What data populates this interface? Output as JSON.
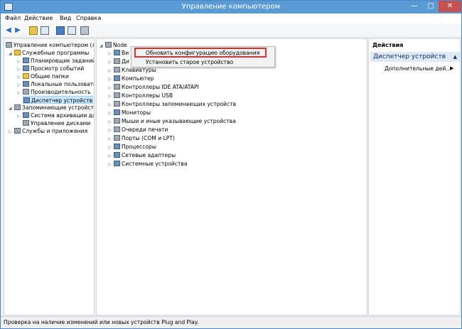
{
  "window": {
    "title": "Управление компьютером"
  },
  "menu": [
    "Файл",
    "Действие",
    "Вид",
    "Справка"
  ],
  "left_tree": [
    {
      "label": "Управление компьютером (л",
      "icon": "computer-management-icon"
    },
    {
      "label": "Служебные программы",
      "icon": "tools-icon"
    },
    {
      "label": "Планировщик заданий",
      "icon": "task-scheduler-icon"
    },
    {
      "label": "Просмотр событий",
      "icon": "event-viewer-icon"
    },
    {
      "label": "Общие папки",
      "icon": "shared-folder-icon"
    },
    {
      "label": "Локальные пользовате",
      "icon": "users-icon"
    },
    {
      "label": "Производительность",
      "icon": "performance-icon"
    },
    {
      "label": "Диспетчер устройств",
      "icon": "device-manager-icon"
    },
    {
      "label": "Запоминающие устройст",
      "icon": "storage-icon"
    },
    {
      "label": "Система архивации да",
      "icon": "backup-icon"
    },
    {
      "label": "Управление дисками",
      "icon": "disk-management-icon"
    },
    {
      "label": "Службы и приложения",
      "icon": "services-icon"
    }
  ],
  "device_tree": {
    "root": "Node",
    "items": [
      "Ви",
      "Ди",
      "Клавиатуры",
      "Компьютер",
      "Контроллеры IDE ATA/ATAPI",
      "Контроллеры USB",
      "Контроллеры запоминающих устройств",
      "Мониторы",
      "Мыши и иные указывающие устройства",
      "Очереди печати",
      "Порты (COM и LPT)",
      "Процессоры",
      "Сетевые адаптеры",
      "Системные устройства"
    ]
  },
  "context_menu": {
    "items": [
      "Обновить конфигурацию оборудования",
      "Установить старое устройство"
    ],
    "highlight_color": "#e03030"
  },
  "actions": {
    "header": "Действия",
    "group": "Диспетчер устройств",
    "item": "Дополнительные дей..."
  },
  "status": "Проверка на наличие изменений или новых устройств Plug and Play."
}
